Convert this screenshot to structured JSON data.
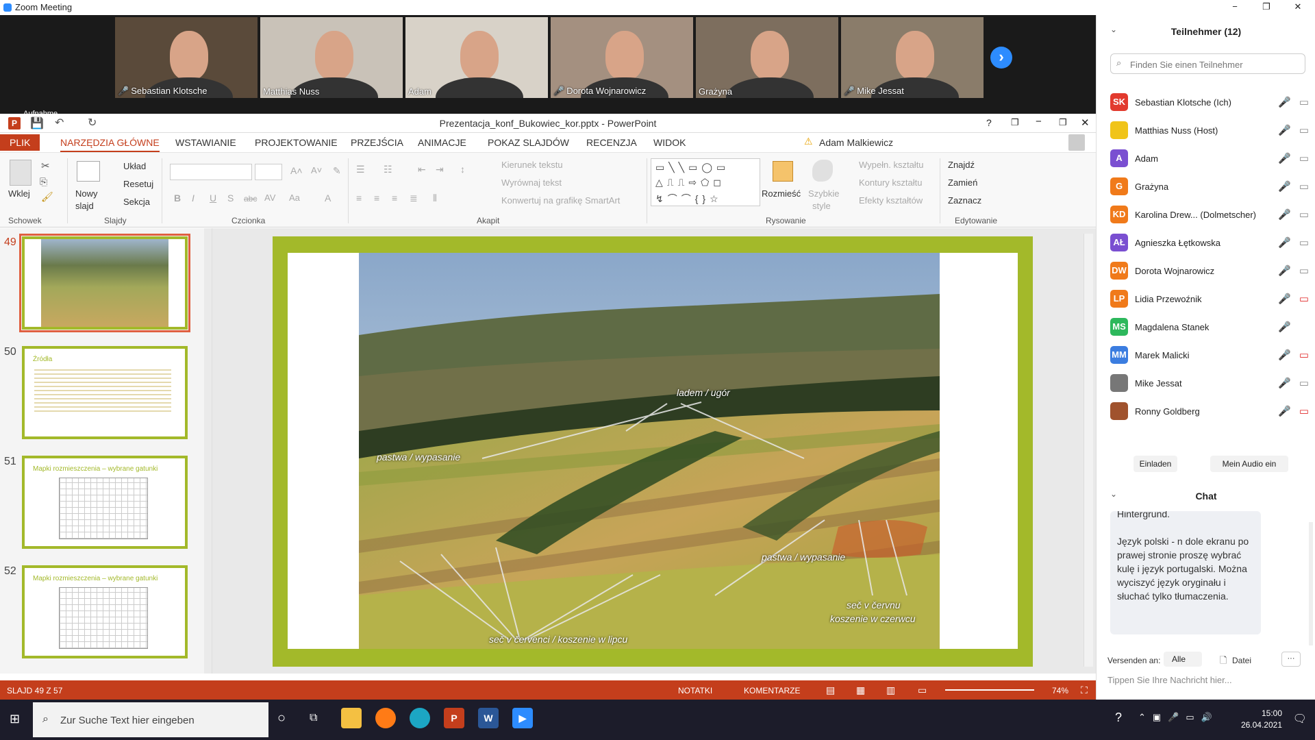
{
  "window": {
    "title": "Zoom Meeting",
    "min": "−",
    "restore": "❐",
    "close": "✕"
  },
  "video": {
    "tiles": [
      {
        "name": "Sebastian Klotsche",
        "muted": true,
        "bg": "#5a4a3a"
      },
      {
        "name": "Matthias Nuss",
        "muted": false,
        "bg": "#c9c2b8"
      },
      {
        "name": "Adam",
        "muted": false,
        "bg": "#d8d2c8"
      },
      {
        "name": "Dorota Wojnarowicz",
        "muted": true,
        "bg": "#a49080"
      },
      {
        "name": "Grażyna",
        "muted": false,
        "bg": "#7d6e5e"
      },
      {
        "name": "Mike Jessat",
        "muted": true,
        "bg": "#8a7c6a"
      }
    ],
    "next": "›",
    "recording": "Aufnahme"
  },
  "ppt": {
    "doc_title": "Prezentacja_konf_Bukowiec_kor.pptx - PowerPoint",
    "help": "?",
    "restore": "❐",
    "min": "−",
    "max": "❐",
    "close": "✕",
    "tabs": [
      "PLIK",
      "NARZĘDZIA GŁÓWNE",
      "WSTAWIANIE",
      "PROJEKTOWANIE",
      "PRZEJŚCIA",
      "ANIMACJE",
      "POKAZ SLAJDÓW",
      "RECENZJA",
      "WIDOK"
    ],
    "user": "Adam Malkiewicz",
    "ribbon": {
      "paste": "Wklej",
      "new_slide_1": "Nowy",
      "new_slide_2": "slajd",
      "layout": "Układ",
      "reset": "Resetuj",
      "section": "Sekcja",
      "text_dir": "Kierunek tekstu",
      "align_text": "Wyrównaj tekst",
      "smartart": "Konwertuj na grafikę SmartArt",
      "arrange": "Rozmieść",
      "quick_1": "Szybkie",
      "quick_2": "style",
      "fill": "Wypełn. kształtu",
      "outline": "Kontury kształtu",
      "effects": "Efekty kształtów",
      "find": "Znajdź",
      "replace": "Zamień",
      "select": "Zaznacz",
      "groups": {
        "clipboard": "Schowek",
        "slides": "Slajdy",
        "font": "Czcionka",
        "paragraph": "Akapit",
        "drawing": "Rysowanie",
        "editing": "Edytowanie"
      }
    },
    "thumbs": [
      {
        "num": "49",
        "title": ""
      },
      {
        "num": "50",
        "title": "Źródła"
      },
      {
        "num": "51",
        "title": "Mapki rozmieszczenia – wybrane gatunki"
      },
      {
        "num": "52",
        "title": "Mapki rozmieszczenia – wybrane gatunki"
      }
    ],
    "slide_labels": {
      "fallow": "ladem / ugór",
      "pasture1": "pastwa / wypasanie",
      "pasture2": "pastwa / wypasanie",
      "june": "seč v červnu",
      "june2": "koszenie w czerwcu",
      "july": "seč v červenci / koszenie w lipcu"
    },
    "status": {
      "slide": "SLAJD 49 Z 57",
      "notes": "NOTATKI",
      "comments": "KOMENTARZE",
      "zoom": "74%"
    }
  },
  "side": {
    "participants_title": "Teilnehmer (12)",
    "search_placeholder": "Finden Sie einen Teilnehmer",
    "participants": [
      {
        "initials": "SK",
        "name": "Sebastian Klotsche (Ich)",
        "color": "#e23a2e",
        "mic": "off",
        "video": "on"
      },
      {
        "initials": "",
        "name": "Matthias Nuss (Host)",
        "color": "#f0c419",
        "mic": "on",
        "video": "on"
      },
      {
        "initials": "A",
        "name": "Adam",
        "color": "#7a4fd1",
        "mic": "on",
        "video": "on"
      },
      {
        "initials": "G",
        "name": "Grażyna",
        "color": "#f07a1a",
        "mic": "on",
        "video": "on"
      },
      {
        "initials": "KD",
        "name": "Karolina Drew... (Dolmetscher)",
        "color": "#f07a1a",
        "mic": "on",
        "video": "on"
      },
      {
        "initials": "AŁ",
        "name": "Agnieszka Łętkowska",
        "color": "#7a4fd1",
        "mic": "off",
        "video": "on"
      },
      {
        "initials": "DW",
        "name": "Dorota Wojnarowicz",
        "color": "#f07a1a",
        "mic": "off",
        "video": "on"
      },
      {
        "initials": "LP",
        "name": "Lidia Przewoźnik",
        "color": "#f07a1a",
        "mic": "off",
        "video": "off"
      },
      {
        "initials": "MS",
        "name": "Magdalena Stanek",
        "color": "#2db85c",
        "mic": "off",
        "video": "none"
      },
      {
        "initials": "MM",
        "name": "Marek Malicki",
        "color": "#3b7de0",
        "mic": "off",
        "video": "off"
      },
      {
        "initials": "",
        "name": "Mike Jessat",
        "color": "#777",
        "mic": "off",
        "video": "on"
      },
      {
        "initials": "",
        "name": "Ronny Goldberg",
        "color": "#a0522d",
        "mic": "off",
        "video": "off"
      }
    ],
    "invite": "Einladen",
    "audio": "Mein Audio ein",
    "chat_title": "Chat",
    "chat_cut": "Hintergrund.",
    "chat_msg": "Język polski - n dole ekranu po prawej stronie proszę wybrać kulę i język portugalski. Można wyciszyć język oryginału i słuchać tylko tłumaczenia.",
    "send_to": "Versenden an:",
    "send_to_value": "Alle",
    "file": "Datei",
    "more": "···",
    "input_placeholder": "Tippen Sie Ihre Nachricht hier..."
  },
  "taskbar": {
    "search": "Zur Suche Text hier eingeben",
    "time": "15:00",
    "date": "26.04.2021"
  }
}
